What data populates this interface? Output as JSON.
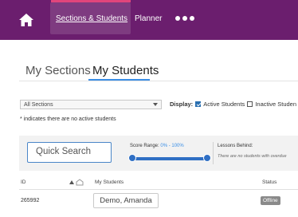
{
  "nav": {
    "home_icon": "home-icon",
    "sections_students": "Sections & Students",
    "planner": "Planner",
    "more_icon": "more-dots-icon"
  },
  "tabs": [
    {
      "label": "My Sections",
      "active": false
    },
    {
      "label": "My Students",
      "active": true
    }
  ],
  "filter_bar": {
    "sections_selected": "All Sections",
    "display_label": "Display:",
    "active_students": {
      "label": "Active Students",
      "checked": true
    },
    "inactive_students": {
      "label": "Inactive Studen",
      "checked": false
    },
    "note": "* indicates there are no active students"
  },
  "filters": {
    "search_placeholder": "Quick Search",
    "score_range_label": "Score Range:",
    "score_range_value": "0% - 100%",
    "score_range": [
      0,
      100
    ],
    "lessons_behind_label": "Lessons Behind:",
    "lessons_behind_empty": "There are no students with overdue"
  },
  "table": {
    "columns": {
      "id": "ID",
      "students": "My Students",
      "status": "Status"
    },
    "rows": [
      {
        "id": "265992",
        "name": "Demo, Amanda",
        "status": "Offline"
      }
    ]
  },
  "colors": {
    "topbar": "#6b1e6e",
    "accent": "#3a8ee6",
    "slider": "#2f6fc4"
  }
}
